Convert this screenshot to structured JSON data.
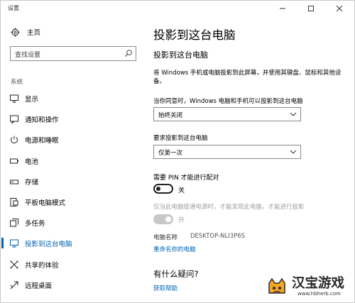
{
  "window": {
    "title": "设置"
  },
  "sidebar": {
    "home_label": "主页",
    "search_placeholder": "查找设置",
    "section_label": "系统",
    "items": [
      {
        "label": "显示",
        "icon": "monitor-icon"
      },
      {
        "label": "通知和操作",
        "icon": "notification-icon"
      },
      {
        "label": "电源和睡眠",
        "icon": "power-icon"
      },
      {
        "label": "电池",
        "icon": "battery-icon"
      },
      {
        "label": "存储",
        "icon": "storage-icon"
      },
      {
        "label": "平板电脑模式",
        "icon": "tablet-mode-icon"
      },
      {
        "label": "多任务",
        "icon": "multitasking-icon"
      },
      {
        "label": "投影到这台电脑",
        "icon": "project-icon",
        "active": true
      },
      {
        "label": "共享的体验",
        "icon": "shared-experience-icon"
      },
      {
        "label": "远程桌面",
        "icon": "remote-desktop-icon"
      }
    ]
  },
  "main": {
    "title": "投影到这台电脑",
    "subtitle": "投影到这台电脑",
    "description": "将 Windows 手机或电脑投影到此屏幕，并使用其键盘、鼠标和其他设备。",
    "agree_label": "当你同意时，Windows 电脑和手机可以投影到这台电脑",
    "agree_value": "始终关闭",
    "request_label": "要求投影到这台电脑",
    "request_value": "仅第一次",
    "pin_label": "需要 PIN 才能进行配对",
    "pin_state": "关",
    "power_label": "仅当此电脑接通电源时，才能发现此电脑，才能进行投影",
    "power_state": "开",
    "pc_name_label": "电脑名称",
    "pc_name_value": "DESKTOP-NLI3P6S",
    "rename_link": "重命名你的电脑",
    "question_heading": "有什么疑问?",
    "help_link": "获取帮助"
  },
  "watermark": {
    "brand": "汉宝游戏",
    "url": "www.hbherb.com"
  },
  "colors": {
    "accent": "#0063b1"
  }
}
